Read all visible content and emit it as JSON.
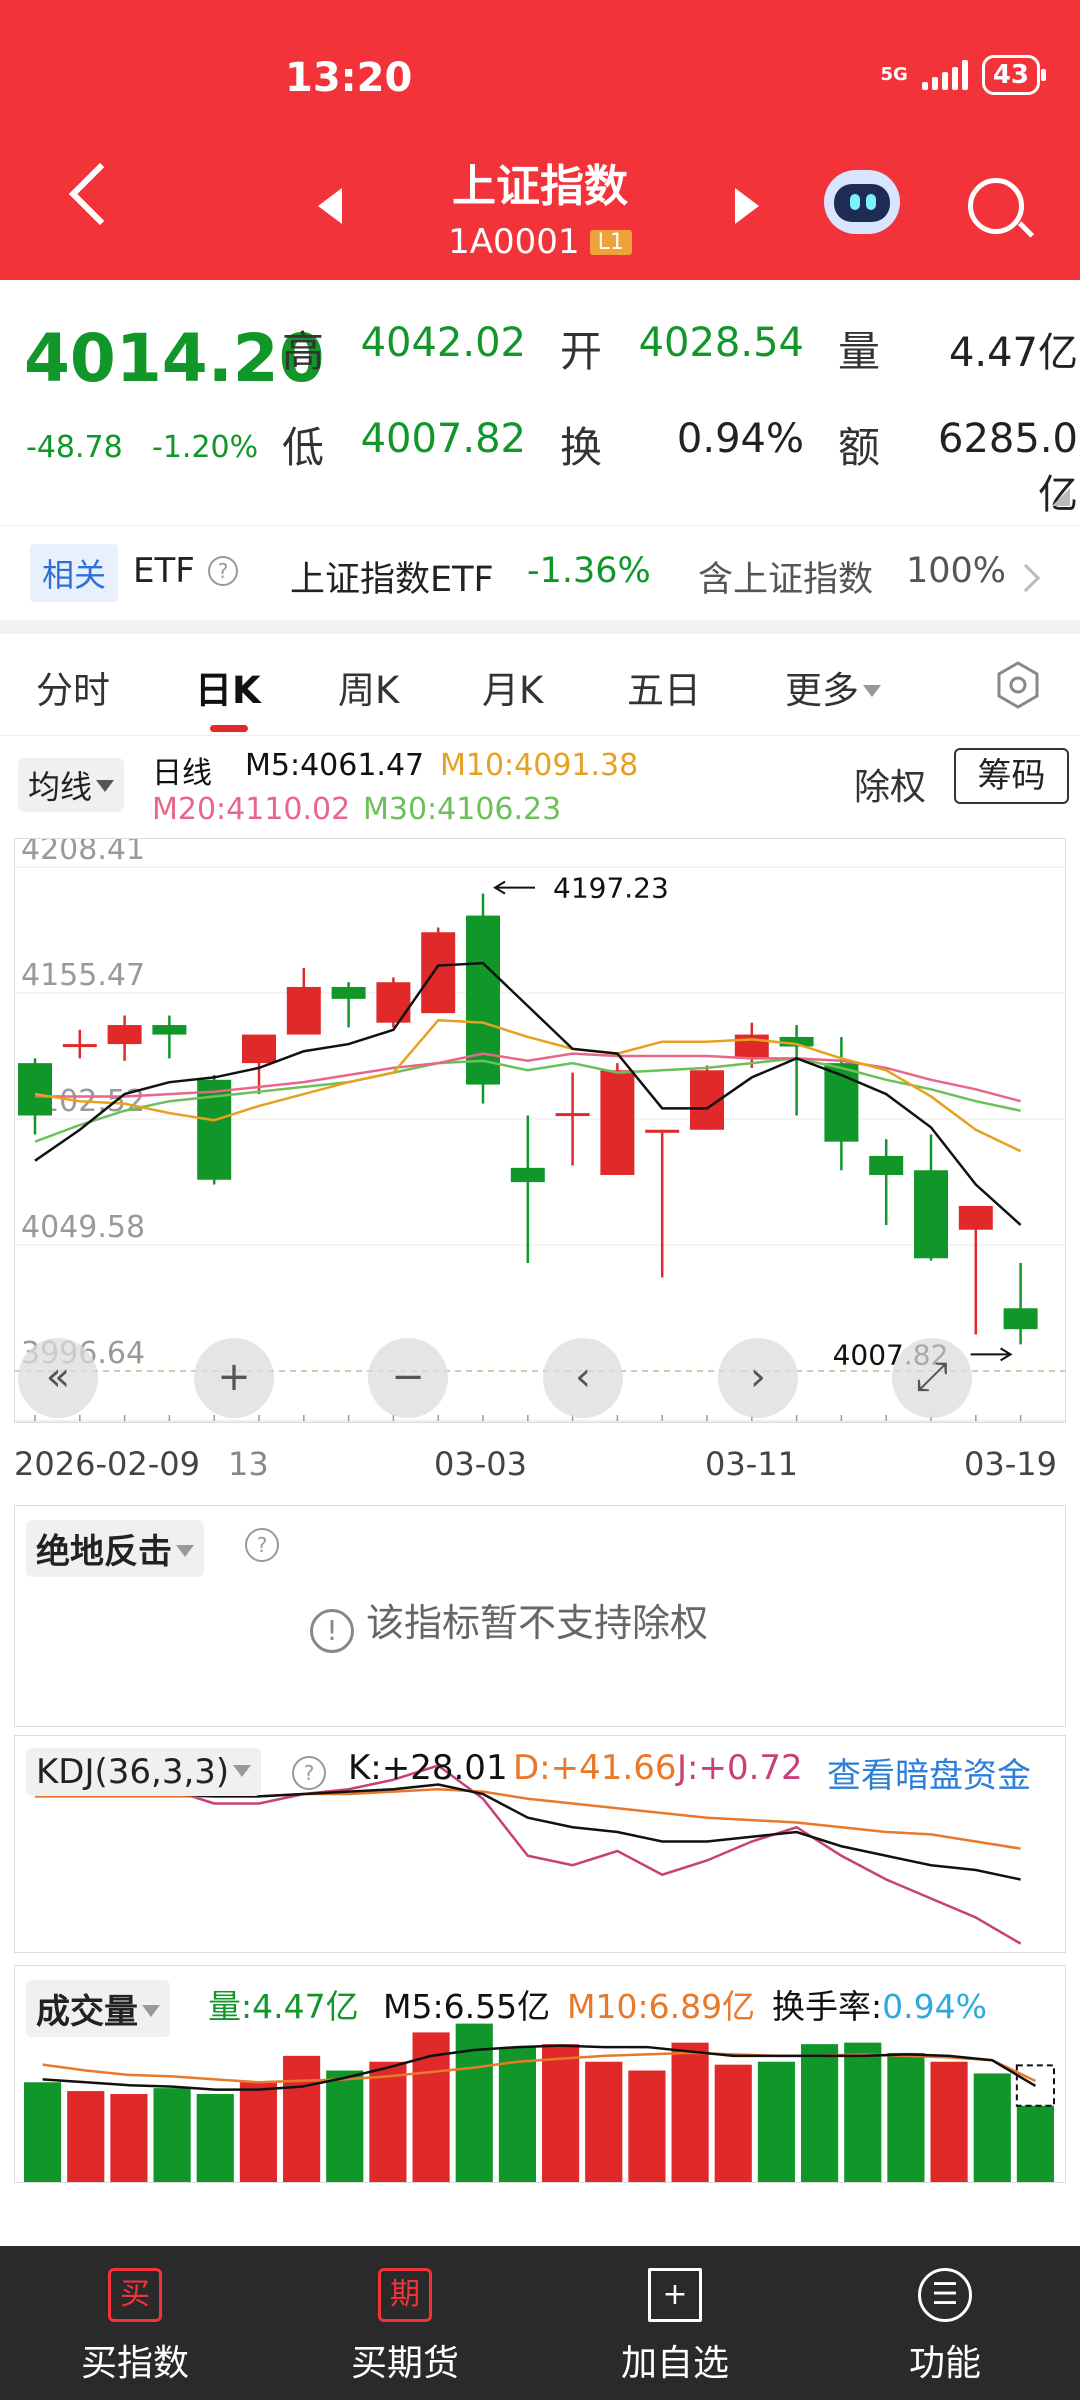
{
  "status": {
    "time": "13:20",
    "network": "5G",
    "battery": "43"
  },
  "header": {
    "title": "上证指数",
    "code": "1A0001",
    "level_badge": "L1"
  },
  "quote": {
    "price": "4014.20",
    "change": "-48.78",
    "change_pct": "-1.20%",
    "high_label": "高",
    "high": "4042.02",
    "open_label": "开",
    "open": "4028.54",
    "volume_label": "量",
    "volume": "4.47亿",
    "low_label": "低",
    "low": "4007.82",
    "turnover_label": "换",
    "turnover": "0.94%",
    "amount_label": "额",
    "amount": "6285.0亿"
  },
  "etf_bar": {
    "tag": "相关",
    "label": "ETF",
    "name": "上证指数ETF",
    "change": "-1.36%",
    "holding_label": "含上证指数",
    "holding_pct": "100%"
  },
  "tabs": [
    "分时",
    "日K",
    "周K",
    "月K",
    "五日",
    "更多"
  ],
  "active_tab": "日K",
  "ma_legend": {
    "selector": "均线",
    "period": "日线",
    "m5": "M5:4061.47",
    "m10": "M10:4091.38",
    "m20": "M20:4110.02",
    "m30": "M30:4106.23",
    "rights_label": "除权",
    "chips_button": "筹码"
  },
  "colors": {
    "up": "#e02a2a",
    "down": "#11962a",
    "m5": "#111111",
    "m10": "#e8a020",
    "m20": "#e8668a",
    "m30": "#6cc05a",
    "accent": "#f2333a"
  },
  "chart_data": {
    "type": "candlestick",
    "y_tick_labels": [
      "4208.41",
      "4155.47",
      "4102.52",
      "4049.58",
      "3996.64"
    ],
    "ylim": [
      3996.64,
      4208.41
    ],
    "annotations": {
      "max": "4197.23",
      "min": "4007.82"
    },
    "x_labels": [
      "2026-02-09",
      "13",
      "03-03",
      "03-11",
      "03-19"
    ],
    "candles": [
      {
        "o": 4126,
        "h": 4128,
        "l": 4096,
        "c": 4104
      },
      {
        "o": 4134,
        "h": 4140,
        "l": 4128,
        "c": 4134
      },
      {
        "o": 4134,
        "h": 4146,
        "l": 4127,
        "c": 4142
      },
      {
        "o": 4142,
        "h": 4146,
        "l": 4128,
        "c": 4138
      },
      {
        "o": 4119,
        "h": 4121,
        "l": 4075,
        "c": 4077
      },
      {
        "o": 4126,
        "h": 4130,
        "l": 4113,
        "c": 4138
      },
      {
        "o": 4138,
        "h": 4166,
        "l": 4138,
        "c": 4158
      },
      {
        "o": 4158,
        "h": 4160,
        "l": 4141,
        "c": 4153
      },
      {
        "o": 4143,
        "h": 4162,
        "l": 4141,
        "c": 4160
      },
      {
        "o": 4147,
        "h": 4183,
        "l": 4147,
        "c": 4181
      },
      {
        "o": 4188,
        "h": 4197.23,
        "l": 4109,
        "c": 4117
      },
      {
        "o": 4082,
        "h": 4104,
        "l": 4042,
        "c": 4076
      },
      {
        "o": 4105,
        "h": 4122,
        "l": 4083,
        "c": 4105
      },
      {
        "o": 4079,
        "h": 4126,
        "l": 4079,
        "c": 4123
      },
      {
        "o": 4098,
        "h": 4098,
        "l": 4036,
        "c": 4098
      },
      {
        "o": 4098,
        "h": 4125,
        "l": 4098,
        "c": 4123
      },
      {
        "o": 4128,
        "h": 4143,
        "l": 4124,
        "c": 4138
      },
      {
        "o": 4137,
        "h": 4142,
        "l": 4104,
        "c": 4133
      },
      {
        "o": 4126,
        "h": 4137,
        "l": 4081,
        "c": 4093
      },
      {
        "o": 4087,
        "h": 4094,
        "l": 4058,
        "c": 4079
      },
      {
        "o": 4081,
        "h": 4096,
        "l": 4043,
        "c": 4044
      },
      {
        "o": 4056,
        "h": 4065,
        "l": 4012,
        "c": 4066
      },
      {
        "o": 4023,
        "h": 4042.02,
        "l": 4007.82,
        "c": 4014.2
      }
    ],
    "ma": {
      "m5": [
        4085,
        4098,
        4113,
        4118,
        4120,
        4124,
        4131,
        4134,
        4140,
        4167,
        4168,
        4150,
        4132,
        4130,
        4107,
        4107,
        4120,
        4128,
        4121,
        4113,
        4099,
        4075,
        4058
      ],
      "m10": [
        4113,
        4110,
        4109,
        4105,
        4102,
        4108,
        4113,
        4118,
        4122,
        4144,
        4143,
        4137,
        4132,
        4130,
        4135,
        4135,
        4136,
        4134,
        4128,
        4123,
        4112,
        4098,
        4089
      ],
      "m20": [
        4112,
        4112,
        4112,
        4113,
        4114,
        4116,
        4118,
        4121,
        4124,
        4126,
        4130,
        4127,
        4130,
        4129,
        4129,
        4129,
        4128,
        4128,
        4127,
        4124,
        4119,
        4115,
        4110
      ],
      "m30": [
        4093,
        4100,
        4106,
        4110,
        4112,
        4114,
        4116,
        4118,
        4122,
        4126,
        4127,
        4123,
        4126,
        4122,
        4123,
        4124,
        4126,
        4128,
        4124,
        4119,
        4115,
        4110,
        4106
      ]
    }
  },
  "controls": [
    "«",
    "+",
    "−",
    "‹",
    "›",
    "⤢"
  ],
  "indicator1": {
    "name": "绝地反击",
    "notice": "该指标暂不支持除权"
  },
  "kdj": {
    "name": "KDJ(36,3,3)",
    "k": "K:+28.01",
    "d": "D:+41.66",
    "j": "J:+0.72",
    "link": "查看暗盘资金",
    "k_vals": [
      64,
      64,
      64,
      64,
      63,
      63,
      64,
      65,
      66,
      68,
      64,
      54,
      50,
      48,
      44,
      44,
      46,
      48,
      42,
      38,
      34,
      32,
      28
    ],
    "d_vals": [
      63,
      63,
      63,
      63,
      63,
      63,
      64,
      64,
      65,
      66,
      65,
      62,
      60,
      58,
      56,
      54,
      53,
      52,
      50,
      48,
      47,
      44,
      41
    ],
    "j_vals": [
      63,
      66,
      68,
      66,
      60,
      60,
      64,
      66,
      70,
      76,
      62,
      38,
      34,
      40,
      30,
      36,
      44,
      50,
      38,
      28,
      20,
      12,
      1
    ],
    "range": [
      0,
      80
    ]
  },
  "volume": {
    "name": "成交量",
    "vol": "量:4.47亿",
    "m5": "M5:6.55亿",
    "m10": "M10:6.89亿",
    "turnover": "换手率:0.94%",
    "bars": [
      6.8,
      6.2,
      6.0,
      6.4,
      6.0,
      6.8,
      8.6,
      7.6,
      8.2,
      10.2,
      10.8,
      9.2,
      9.4,
      8.2,
      7.6,
      9.5,
      8.0,
      8.2,
      9.4,
      9.5,
      8.8,
      8.2,
      7.4,
      5.2
    ],
    "m5_vals": [
      7.0,
      6.8,
      6.6,
      6.5,
      6.3,
      6.3,
      6.5,
      7.1,
      7.8,
      8.6,
      9.0,
      9.2,
      9.3,
      9.2,
      9.2,
      8.9,
      8.6,
      8.6,
      8.6,
      8.6,
      8.7,
      8.6,
      8.3,
      6.55
    ],
    "m10_vals": [
      8.0,
      7.6,
      7.3,
      7.2,
      7.0,
      6.8,
      6.9,
      7.0,
      7.2,
      7.5,
      7.8,
      8.2,
      8.4,
      8.6,
      8.7,
      8.8,
      8.7,
      8.6,
      8.6,
      8.7,
      8.6,
      8.5,
      8.3,
      6.89
    ],
    "ymax": 12
  },
  "bottom_nav": [
    {
      "icon": "买",
      "label": "买指数"
    },
    {
      "icon": "期",
      "label": "买期货"
    },
    {
      "icon": "+",
      "label": "加自选"
    },
    {
      "icon": "☰",
      "label": "功能"
    }
  ]
}
